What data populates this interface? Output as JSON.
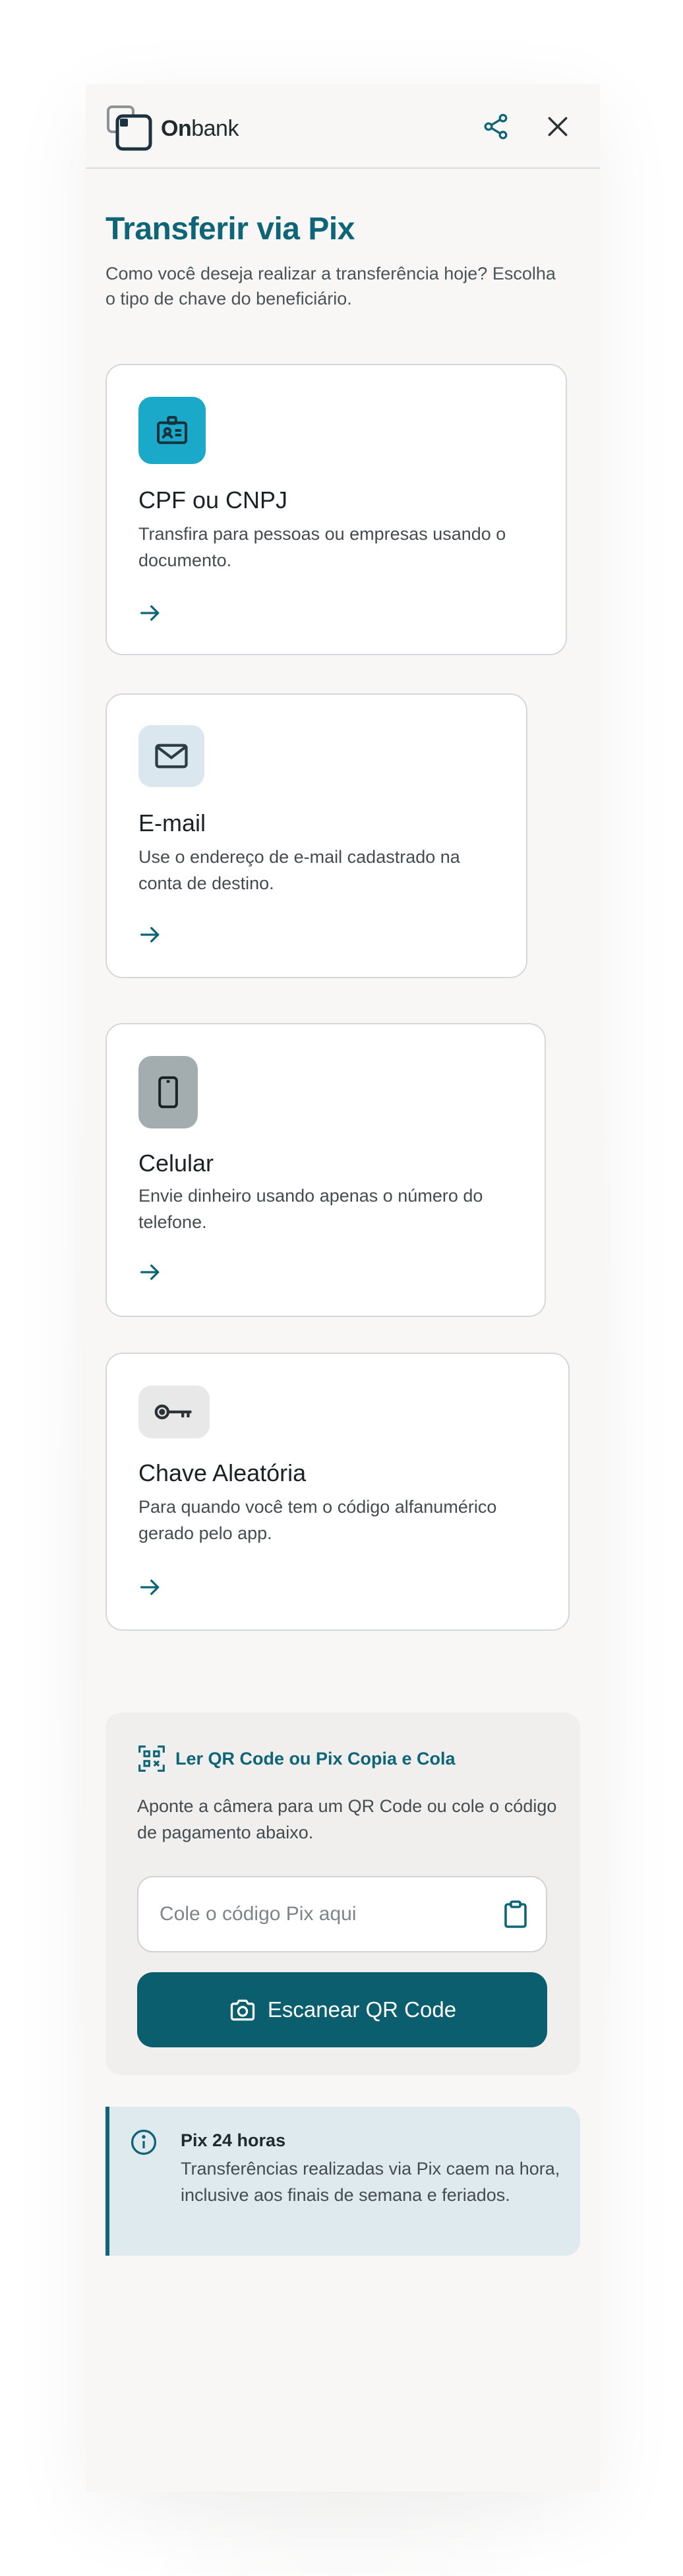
{
  "brand": {
    "name_bold": "On",
    "name_rest": "bank"
  },
  "header": {
    "share_icon": "share-icon",
    "close_icon": "close-icon"
  },
  "page": {
    "title": "Transferir via Pix",
    "subtitle": "Como você deseja realizar a transferência hoje? Escolha o tipo de chave do beneficiário."
  },
  "options": [
    {
      "key": "cpf",
      "title": "CPF ou CNPJ",
      "description": "Transfira para pessoas ou empresas usando o documento.",
      "icon": "id-badge-icon",
      "icon_bg": "#1aa9c9"
    },
    {
      "key": "email",
      "title": "E-mail",
      "description": "Use o endereço de e-mail cadastrado na conta de destino.",
      "icon": "mail-icon",
      "icon_bg": "#dbe7ee"
    },
    {
      "key": "phone",
      "title": "Celular",
      "description": "Envie dinheiro usando apenas o número do telefone.",
      "icon": "phone-icon",
      "icon_bg": "#a3acae"
    },
    {
      "key": "random",
      "title": "Chave Aleatória",
      "description": "Para quando você tem o código alfanumérico gerado pelo app.",
      "icon": "key-icon",
      "icon_bg": "#e8e8e8"
    }
  ],
  "qr": {
    "link_label": "Ler QR Code ou Pix Copia e Cola",
    "description": "Aponte a câmera para um QR Code ou cole o código de pagamento abaixo.",
    "input_placeholder": "Cole o código Pix aqui",
    "input_value": "",
    "scan_label": "Escanear QR Code"
  },
  "info": {
    "title": "Pix 24 horas",
    "text": "Transferências realizadas via Pix caem na hora, inclusive aos finais de semana e feriados."
  },
  "colors": {
    "primary": "#0d6577",
    "button": "#0b5e6d",
    "accent": "#1aa9c9"
  }
}
